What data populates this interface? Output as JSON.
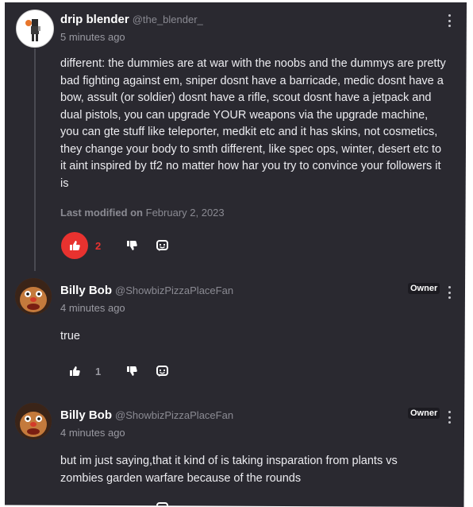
{
  "comments": [
    {
      "author": "drip blender",
      "handle": "@the_blender_",
      "time": "5 minutes ago",
      "badge": "",
      "body": "different: the dummies are at war with the noobs and the dummys are pretty bad fighting against em, sniper dosnt have a barricade, medic dosnt have a bow, assult (or soldier) dosnt have a rifle, scout dosnt have a jetpack and dual pistols, you can upgrade YOUR weapons via the upgrade machine, you can gte stuff like teleporter, medkit etc and it has skins, not cosmetics, they change your body to smth different, like spec ops, winter, desert etc to it aint inspired by tf2 no matter how har you try to convince your followers it is",
      "modified_label": "Last modified on",
      "modified_date": "February 2, 2023",
      "likes": "2",
      "liked": true
    },
    {
      "author": "Billy Bob",
      "handle": "@ShowbizPizzaPlaceFan",
      "time": "4 minutes ago",
      "badge": "Owner",
      "body": "true",
      "likes": "1",
      "liked": false
    },
    {
      "author": "Billy Bob",
      "handle": "@ShowbizPizzaPlaceFan",
      "time": "4 minutes ago",
      "badge": "Owner",
      "body": "but im just saying,that it kind of is taking insparation from plants vs zombies garden warfare because of the rounds",
      "likes": "",
      "liked": false
    }
  ],
  "icons": {
    "like": "thumbs-up-icon",
    "dislike": "thumbs-down-icon",
    "reply": "reply-icon",
    "more": "more-options-icon"
  },
  "colors": {
    "background": "#2a2930",
    "like_active": "#e8322f",
    "text": "#ececf0",
    "muted": "#8a8a92"
  }
}
